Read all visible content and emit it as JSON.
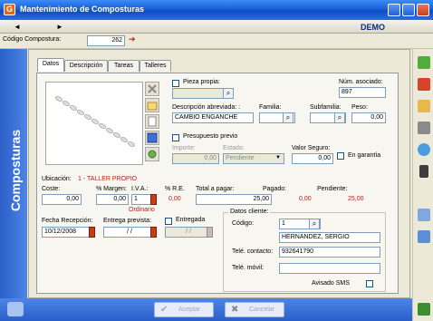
{
  "window": {
    "title": "Mantenimiento de Composturas",
    "app_icon": "app-icon"
  },
  "nav": {
    "prev": "◄",
    "next": "►",
    "mode": "DEMO"
  },
  "code": {
    "label": "Código Compostura:",
    "value": "262"
  },
  "sidebar": {
    "title": "Composturas"
  },
  "tabs": [
    "Datos",
    "Descripción",
    "Tareas",
    "Talleres"
  ],
  "piece": {
    "pieza_label": "Pieza propia:",
    "pieza_value": "",
    "num_label": "Núm. asociado:",
    "num_value": "897",
    "desc_label": "Descripción abreviada: :",
    "desc_value": "CAMBIO ENGANCHE",
    "familia_label": "Familia:",
    "familia_value": "",
    "subfamilia_label": "Subfamilia:",
    "subfamilia_value": "",
    "peso_label": "Peso:",
    "peso_value": "0,00",
    "presupuesto_label": "Presupuesto previo",
    "importe_label": "Importe:",
    "importe_value": "0,00",
    "estado_label": "Estado:",
    "estado_value": "Pendiente",
    "valor_label": "Valor Seguro:",
    "valor_value": "0,00",
    "garantia_label": "En garantía"
  },
  "location": {
    "label": "Ubicación:",
    "value": "1 - TALLER PROPIO"
  },
  "money": {
    "coste_label": "Coste:",
    "coste_value": "0,00",
    "margen_label": "% Margen:",
    "margen_value": "0,00",
    "iva_label": "I.V.A.:",
    "iva_value": "1",
    "re_label": "% R.E.",
    "re_value": "0,00",
    "total_label": "Total a pagar:",
    "total_value": "25,00",
    "pagado_label": "Pagado:",
    "pagado_value": "0,00",
    "pendiente_label": "Pendiente:",
    "pendiente_value": "25,00",
    "iva_type": "Ordinario"
  },
  "dates": {
    "recepcion_label": "Fecha Recepción:",
    "recepcion_value": "10/12/2008",
    "prevista_label": "Entrega prevista:",
    "prevista_value": "/ /",
    "entregada_label": "Entregada",
    "entregada_value": "/ /"
  },
  "client": {
    "title": "Datos cliente:",
    "codigo_label": "Código:",
    "codigo_value": "1",
    "name_value": "HERNANDEZ, SERGIO",
    "contacto_label": "Telé. contacto:",
    "contacto_value": "932641790",
    "movil_label": "Telé. móvil:",
    "movil_value": "",
    "sms_label": "Avisado SMS"
  },
  "footer": {
    "accept": "Aceptar",
    "cancel": "Cancelar"
  },
  "colors": {
    "titlebar": "#0b4bc4",
    "sidebar": "#2a5fc8",
    "accent_red": "#b1231a"
  }
}
